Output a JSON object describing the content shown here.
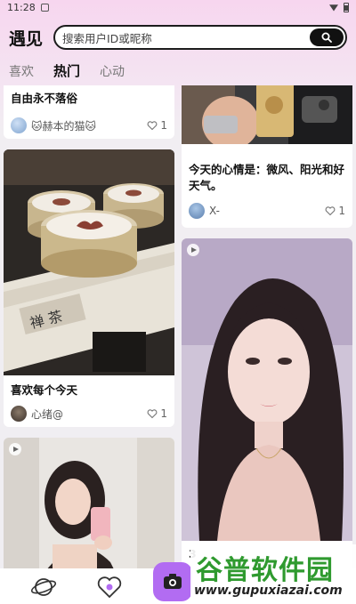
{
  "status": {
    "time": "11:28"
  },
  "header": {
    "title": "遇见",
    "search_placeholder": "搜索用户ID或昵称"
  },
  "tabs": [
    {
      "label": "喜欢"
    },
    {
      "label": "热门",
      "active": true
    },
    {
      "label": "心动"
    }
  ],
  "cards": {
    "left_top": {
      "title": "自由永不落俗",
      "user": "🐱赫本的猫🐱",
      "likes": "1"
    },
    "left_mid": {
      "title": "喜欢每个今天",
      "user": "心绪@",
      "likes": "1"
    },
    "right_top": {
      "title": "今天的心情是：微风、阳光和好天气。",
      "user": "X-",
      "likes": "1"
    },
    "right_bottom": {
      "title": "3"
    }
  },
  "watermark": {
    "line1": "谷普软件园",
    "line2": "www.gupuxiazai.com"
  },
  "colors": {
    "accent": "#b26cf2",
    "tab_active": "#111111"
  }
}
